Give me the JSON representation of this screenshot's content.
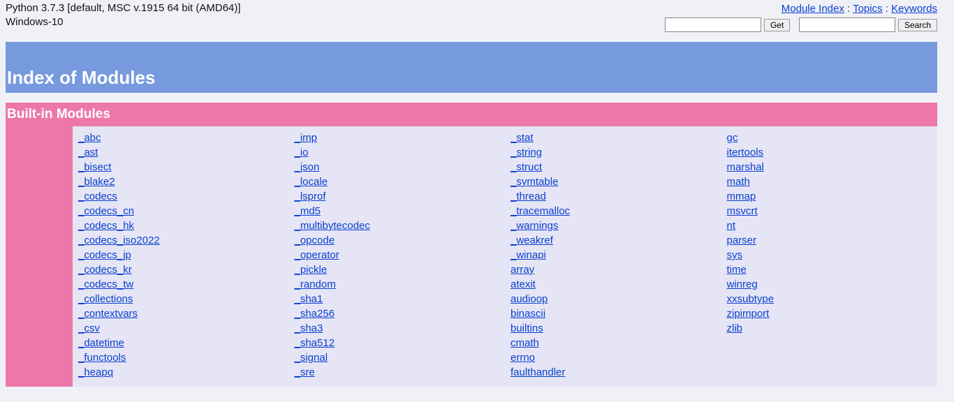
{
  "header": {
    "python_line": "Python 3.7.3 [default, MSC v.1915 64 bit (AMD64)]",
    "os_line": "Windows-10",
    "links": {
      "module_index": "Module Index",
      "topics": "Topics",
      "keywords": "Keywords"
    },
    "get_button": "Get",
    "search_button": "Search"
  },
  "title": "Index of Modules",
  "section_title": "Built-in Modules",
  "columns": [
    [
      "_abc",
      "_ast",
      "_bisect",
      "_blake2",
      "_codecs",
      "_codecs_cn",
      "_codecs_hk",
      "_codecs_iso2022",
      "_codecs_jp",
      "_codecs_kr",
      "_codecs_tw",
      "_collections",
      "_contextvars",
      "_csv",
      "_datetime",
      "_functools",
      "_heapq"
    ],
    [
      "_imp",
      "_io",
      "_json",
      "_locale",
      "_lsprof",
      "_md5",
      "_multibytecodec",
      "_opcode",
      "_operator",
      "_pickle",
      "_random",
      "_sha1",
      "_sha256",
      "_sha3",
      "_sha512",
      "_signal",
      "_sre"
    ],
    [
      "_stat",
      "_string",
      "_struct",
      "_symtable",
      "_thread",
      "_tracemalloc",
      "_warnings",
      "_weakref",
      "_winapi",
      "array",
      "atexit",
      "audioop",
      "binascii",
      "builtins",
      "cmath",
      "errno",
      "faulthandler"
    ],
    [
      "gc",
      "itertools",
      "marshal",
      "math",
      "mmap",
      "msvcrt",
      "nt",
      "parser",
      "sys",
      "time",
      "winreg",
      "xxsubtype",
      "zipimport",
      "zlib"
    ]
  ]
}
